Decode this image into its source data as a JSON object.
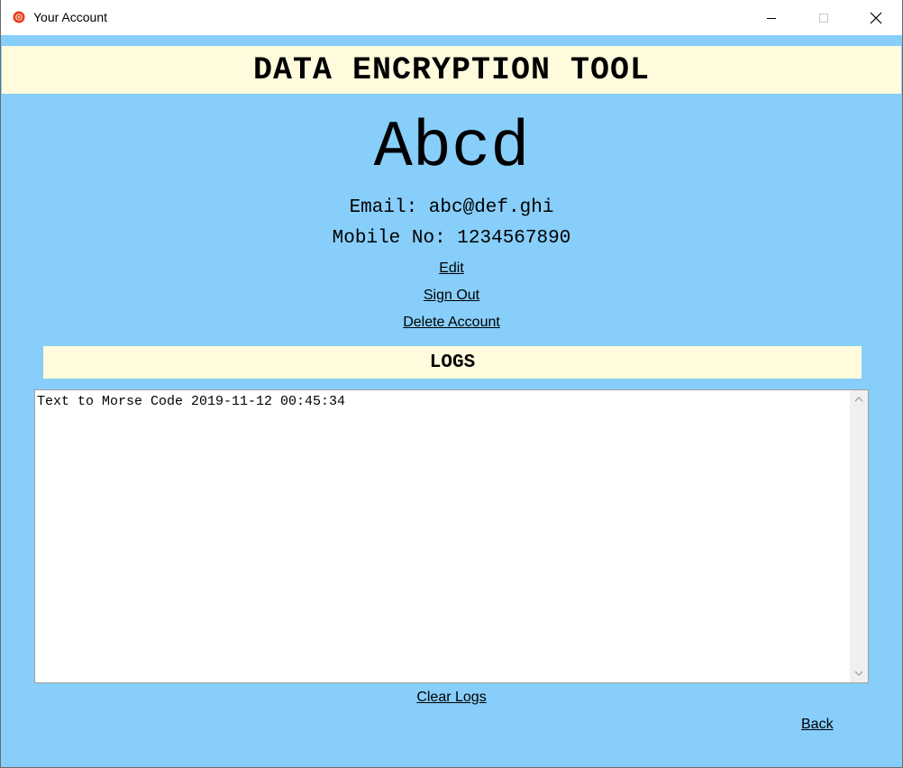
{
  "window": {
    "title": "Your Account",
    "icon": "app-icon",
    "controls": [
      "minimize-icon",
      "maximize-icon",
      "close-icon"
    ]
  },
  "header": {
    "title": "DATA ENCRYPTION TOOL"
  },
  "account": {
    "username": "Abcd",
    "email_line": "Email: abc@def.ghi",
    "mobile_line": "Mobile No: 1234567890"
  },
  "actions": {
    "edit": "Edit",
    "sign_out": "Sign Out",
    "delete_account": "Delete Account"
  },
  "logs": {
    "title": "LOGS",
    "entries": "Text to Morse Code 2019-11-12 00:45:34",
    "clear_label": "Clear Logs"
  },
  "navigation": {
    "back_label": "Back"
  },
  "colors": {
    "background": "#87cefa",
    "banner": "#fffbdc",
    "text": "#000000",
    "titlebar": "#ffffff"
  }
}
